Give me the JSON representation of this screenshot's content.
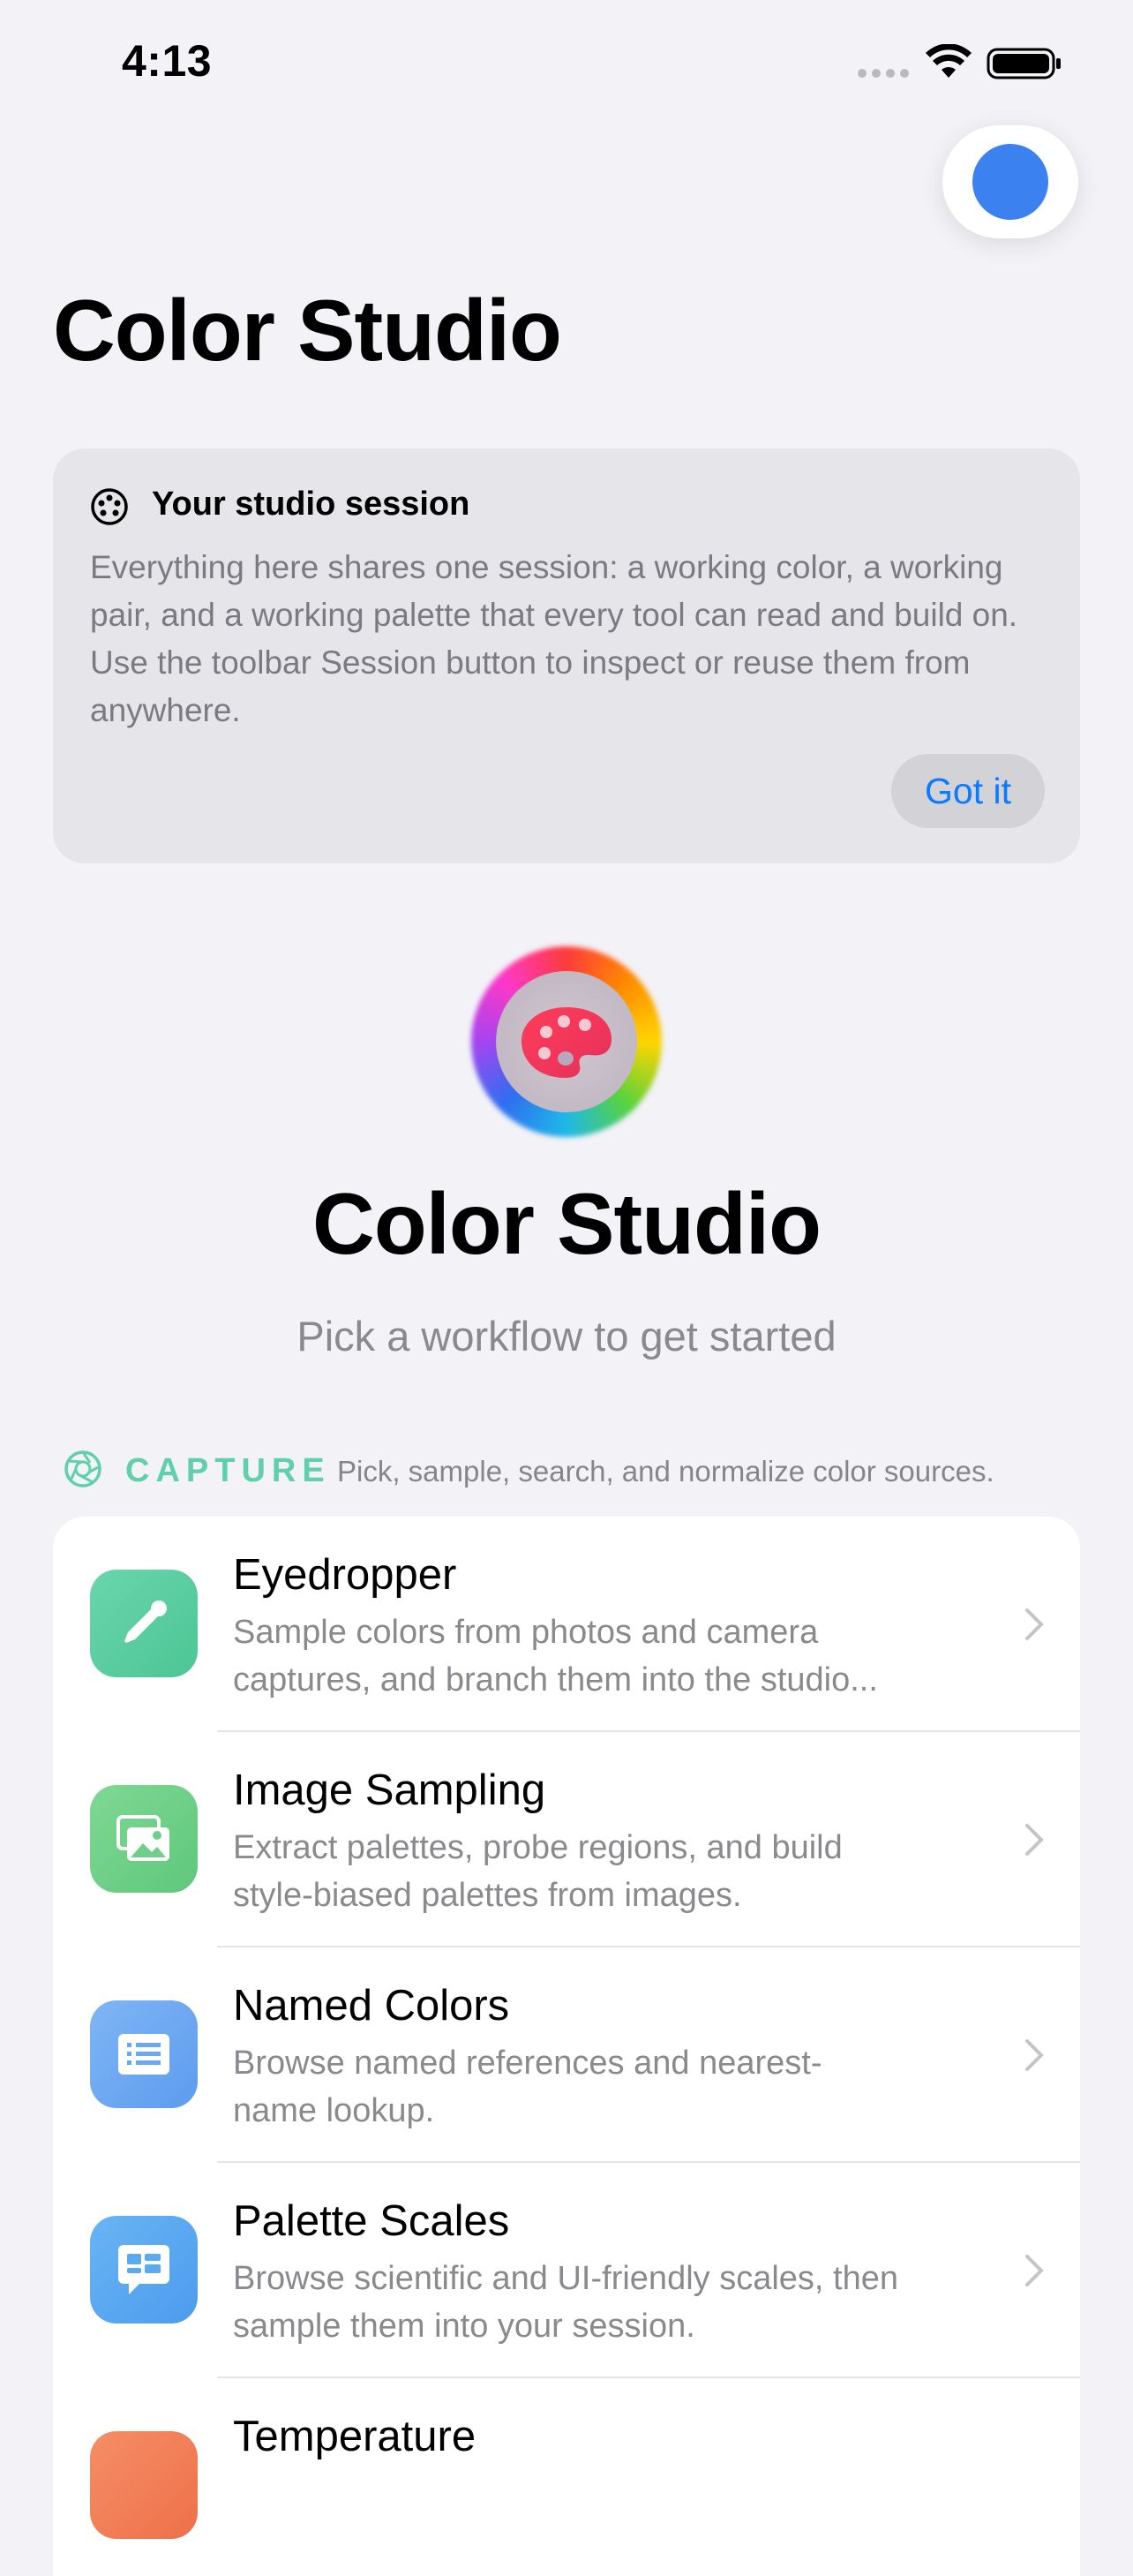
{
  "status_bar": {
    "time": "4:13"
  },
  "header": {
    "title": "Color Studio"
  },
  "tip": {
    "title": "Your studio session",
    "body": "Everything here shares one session: a working color, a working pair, and a working palette that every tool can read and build on. Use the toolbar Session button to inspect or reuse them from anywhere.",
    "button": "Got it"
  },
  "hero": {
    "title": "Color Studio",
    "subtitle": "Pick a workflow to get started"
  },
  "section": {
    "title": "CAPTURE",
    "description": "Pick, sample, search, and normalize color sources.",
    "accent": "#5fd0aa"
  },
  "rows": [
    {
      "title": "Eyedropper",
      "desc": "Sample colors from photos and camera captures, and branch them into the studio...",
      "icon": "eyedropper-icon",
      "color": "#5fd0a0"
    },
    {
      "title": "Image Sampling",
      "desc": "Extract palettes, probe regions, and build style-biased palettes from images.",
      "icon": "photo-stack-icon",
      "color": "#72d187"
    },
    {
      "title": "Named Colors",
      "desc": "Browse named references and nearest-name lookup.",
      "icon": "list-icon",
      "color": "#6aa8f0"
    },
    {
      "title": "Palette Scales",
      "desc": "Browse scientific and UI-friendly scales, then sample them into your session.",
      "icon": "scales-icon",
      "color": "#5aaaf0"
    },
    {
      "title": "Temperature",
      "desc": "",
      "icon": "thermometer-icon",
      "color": "#f0805a"
    }
  ]
}
